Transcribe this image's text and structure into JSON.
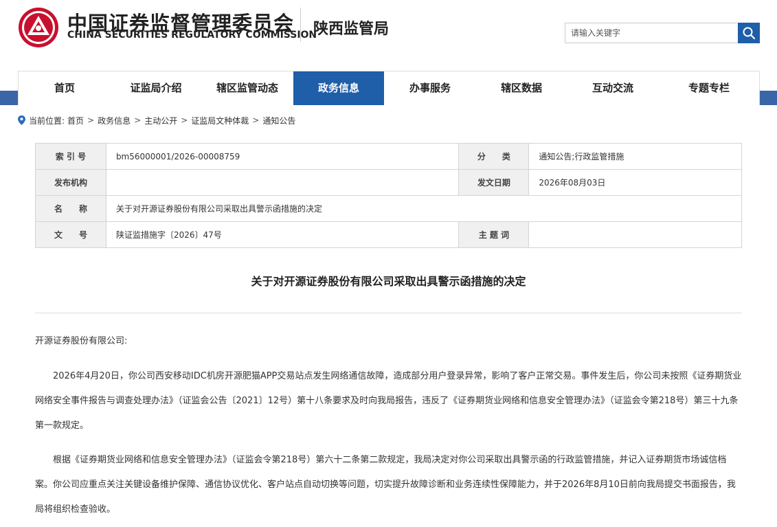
{
  "header": {
    "org_cn": "中国证券监督管理委员会",
    "org_en": "CHINA SECURITIES REGULATORY COMMISSION",
    "branch": "陕西监管局",
    "logo_icon": "csrc-emblem-icon",
    "search": {
      "placeholder": "请输入关键字",
      "icon": "search-icon",
      "button_color": "#1f5ea8"
    }
  },
  "nav": {
    "items": [
      {
        "label": "首页"
      },
      {
        "label": "证监局介绍"
      },
      {
        "label": "辖区监管动态"
      },
      {
        "label": "政务信息",
        "active": true
      },
      {
        "label": "办事服务"
      },
      {
        "label": "辖区数据"
      },
      {
        "label": "互动交流"
      },
      {
        "label": "专题专栏"
      }
    ],
    "active_color": "#1f5ea8",
    "band_color": "#3a66a8"
  },
  "breadcrumb": {
    "prefix": "当前位置:",
    "icon": "location-pin-icon",
    "items": [
      "首页",
      "政务信息",
      "主动公开",
      "证监局文种体裁",
      "通知公告"
    ],
    "separator": ">"
  },
  "meta": {
    "index_label": "索 引 号",
    "index_value": "bm56000001/2026-00008759",
    "category_label": "分　　类",
    "category_value": "通知公告;行政监管措施",
    "issuer_label": "发布机构",
    "issuer_value": "",
    "date_label": "发文日期",
    "date_value": "2026年08月03日",
    "name_label": "名　　称",
    "name_value": "关于对开源证券股份有限公司采取出具警示函措施的决定",
    "docno_label": "文　　号",
    "docno_value": "陕证监措施字〔2026〕47号",
    "keywords_label": "主 题 词",
    "keywords_value": ""
  },
  "document": {
    "title": "关于对开源证券股份有限公司采取出具警示函措施的决定",
    "salutation": "开源证券股份有限公司:",
    "paragraphs": [
      "2026年4月20日，你公司西安移动IDC机房开源肥猫APP交易站点发生网络通信故障，造成部分用户登录异常，影响了客户正常交易。事件发生后，你公司未按照《证券期货业网络安全事件报告与调查处理办法》（证监会公告〔2021〕12号）第十八条要求及时向我局报告，违反了《证券期货业网络和信息安全管理办法》（证监会令第218号）第三十九条第一款规定。",
      "根据《证券期货业网络和信息安全管理办法》（证监会令第218号）第六十二条第二款规定，我局决定对你公司采取出具警示函的行政监管措施，并记入证券期货市场诚信档案。你公司应重点关注关键设备维护保障、通信协议优化、客户站点自动切换等问题，切实提升故障诊断和业务连续性保障能力，并于2026年8月10日前向我局提交书面报告，我局将组织检查验收。"
    ]
  }
}
